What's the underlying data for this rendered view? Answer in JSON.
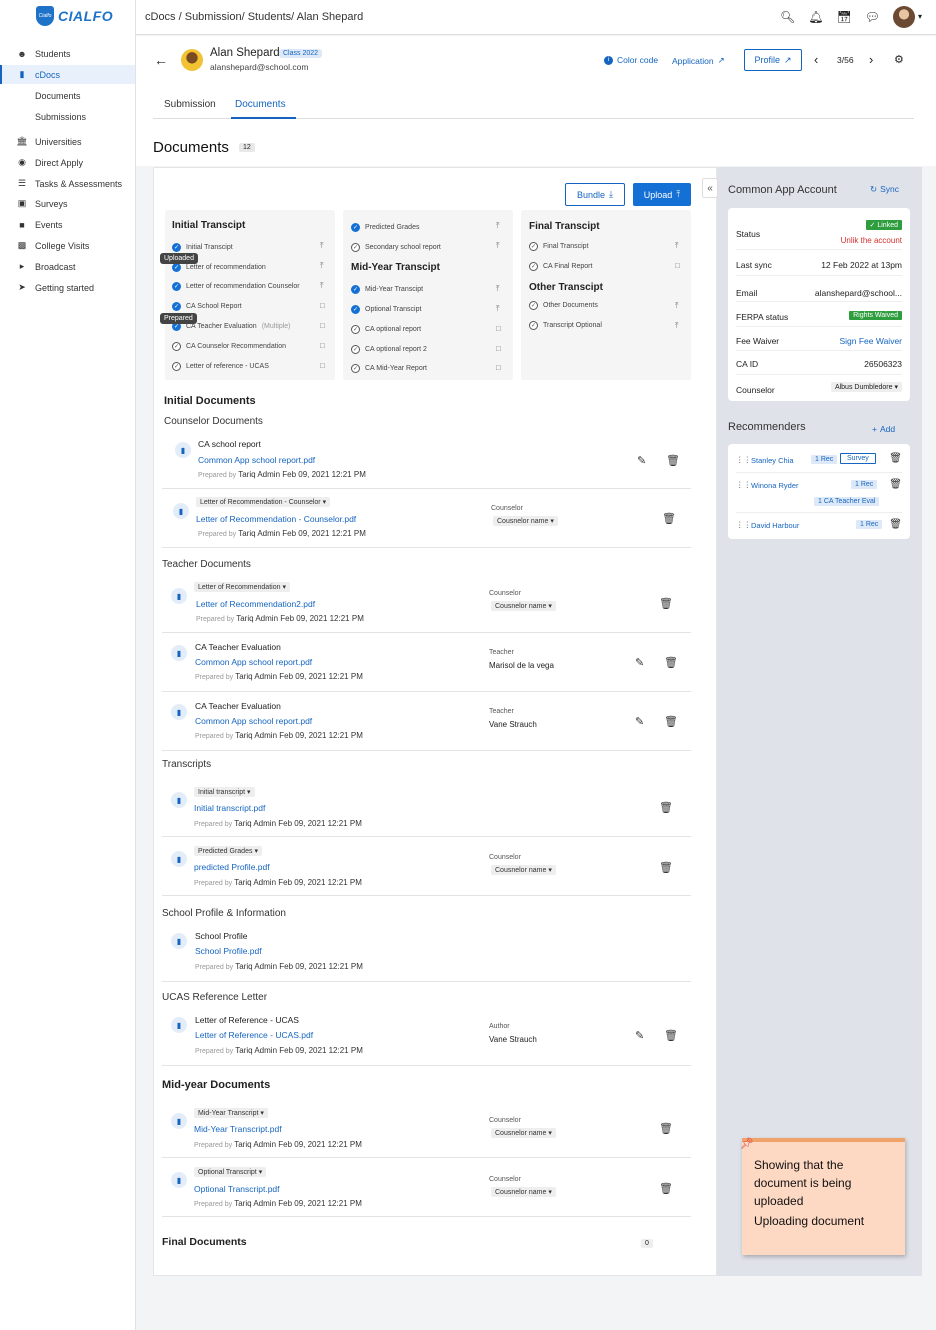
{
  "sidebar": {
    "logo_text": "CIALFO",
    "logo_mark": "Cialfo",
    "items": [
      {
        "label": "Students",
        "icon": "users-icon"
      },
      {
        "label": "cDocs",
        "icon": "document-icon"
      },
      {
        "label": "Documents"
      },
      {
        "label": "Submissions"
      },
      {
        "label": "Universities",
        "icon": "university-icon"
      },
      {
        "label": "Direct Apply",
        "icon": "direct-apply-icon"
      },
      {
        "label": "Tasks & Assessments",
        "icon": "tasks-icon"
      },
      {
        "label": "Surveys",
        "icon": "survey-icon"
      },
      {
        "label": "Events",
        "icon": "video-icon"
      },
      {
        "label": "College Visits",
        "icon": "college-visits-icon"
      },
      {
        "label": "Broadcast",
        "icon": "megaphone-icon"
      },
      {
        "label": "Getting started",
        "icon": "rocket-icon"
      }
    ]
  },
  "header": {
    "breadcrumb": "cDocs / Submission/ Students/ Alan Shepard"
  },
  "student": {
    "name": "Alan Shepard",
    "class_badge": "Class 2022",
    "email": "alanshepard@school.com",
    "color_code": "Color code",
    "application": "Application",
    "profile": "Profile",
    "pager": "3/56"
  },
  "tabs": [
    "Submission",
    "Documents"
  ],
  "documents": {
    "title": "Documents",
    "count": "12",
    "bundle": "Bundle",
    "upload": "Upload"
  },
  "checklist": {
    "col1_head": "Initial Transcipt",
    "col1": [
      "Initial Transcipt",
      "Letter of recommendation",
      "Letter of recommendation Counselor",
      "CA School Report",
      "CA Teacher Evaluation",
      "CA Counselor Recommendation",
      "Letter of reference - UCAS"
    ],
    "col1_multiple": "(Multiple)",
    "tooltip_uploaded": "Uploaded",
    "tooltip_prepared": "Prepared",
    "col2_top": [
      "Predicted Grades",
      "Secondary school report"
    ],
    "col2_head": "Mid-Year Transcipt",
    "col2": [
      "Mid-Year Transcipt",
      "Optional Transcipt",
      "CA optional report",
      "CA optional report 2",
      "CA Mid-Year Report"
    ],
    "col3_head": "Final Transcipt",
    "col3": [
      "Final Transcipt",
      "CA Final Report"
    ],
    "col3b_head": "Other Transcipt",
    "col3b": [
      "Other Documents",
      "Transcript Optional"
    ]
  },
  "sections": {
    "initial": "Initial Documents",
    "counselor": "Counselor Documents",
    "teacher": "Teacher Documents",
    "transcripts": "Transcripts",
    "school_profile": "School Profile & Information",
    "ucas": "UCAS Reference Letter",
    "midyear": "Mid-year Documents",
    "final": "Final Documents",
    "final_count": "0"
  },
  "common": {
    "prepared_by": "Prepared by",
    "prepared_by_nospace": "Prepared by",
    "author": "Tariq Admin Feb 09, 2021 12:21 PM",
    "counselor": "Counselor",
    "counselor_name": "Cousnelor name",
    "teacher": "Teacher",
    "author_label": "Author"
  },
  "docs": {
    "d1_title": "CA school report",
    "d1_link": "Common App school report.pdf",
    "d2_type": "Letter of Recommendation - Counselor",
    "d2_link": "Letter of Recommendation - Counselor.pdf",
    "d3_type": "Letter of Recommendation",
    "d3_link": "Letter of Recommendation2.pdf",
    "d4_title": "CA Teacher Evaluation",
    "d4_link": "Common App school report.pdf",
    "d4_teacher": "Marisol de la vega",
    "d5_title": "CA Teacher Evaluation",
    "d5_link": "Common App school report.pdf",
    "d5_teacher": "Vane Strauch",
    "d6_type": "Initial transcript",
    "d6_link": "Initial transcript.pdf",
    "d7_type": "Predicted Grades",
    "d7_link": "predicted Profile.pdf",
    "d8_title": "School Profile",
    "d8_link": "School Profile.pdf",
    "d9_title": "Letter of Reference - UCAS",
    "d9_link": "Letter of Reference - UCAS.pdf",
    "d9_author": "Vane Strauch",
    "d10_type": "Mid-Year Transcript",
    "d10_link": "Mid-Year Transcript.pdf",
    "d11_type": "Optional Transcript",
    "d11_link": "Optional Transcript.pdf"
  },
  "common_app": {
    "title": "Common App Account",
    "sync": "Sync",
    "status_label": "Status",
    "status_badge": "Linked",
    "unlink": "Unlik the account",
    "last_sync_label": "Last sync",
    "last_sync": "12 Feb 2022 at 13pm",
    "email_label": "Email",
    "email": "alanshepard@school...",
    "ferpa_label": "FERPA status",
    "ferpa": "Rights Waived",
    "fee_label": "Fee Waiver",
    "fee": "Sign Fee Waiver",
    "caid_label": "CA ID",
    "caid": "26506323",
    "counselor_label": "Counselor",
    "counselor": "Albus Dumbledore"
  },
  "recommenders": {
    "title": "Recommenders",
    "add": "Add",
    "items": [
      {
        "name": "Stanley Chia",
        "tag": "1 Rec",
        "extra": "Survey"
      },
      {
        "name": "Winona Ryder",
        "tag": "1 Rec",
        "extra": "1 CA Teacher Eval"
      },
      {
        "name": "David Harbour",
        "tag": "1 Rec"
      }
    ]
  },
  "sticky": {
    "line1": "Showing that the document is being uploaded",
    "line2": "Uploading document"
  },
  "colors": {
    "accent": "#1565c0",
    "success": "#2e9d3e",
    "danger": "#d32f2f",
    "sticky": "#fdd8c3"
  }
}
